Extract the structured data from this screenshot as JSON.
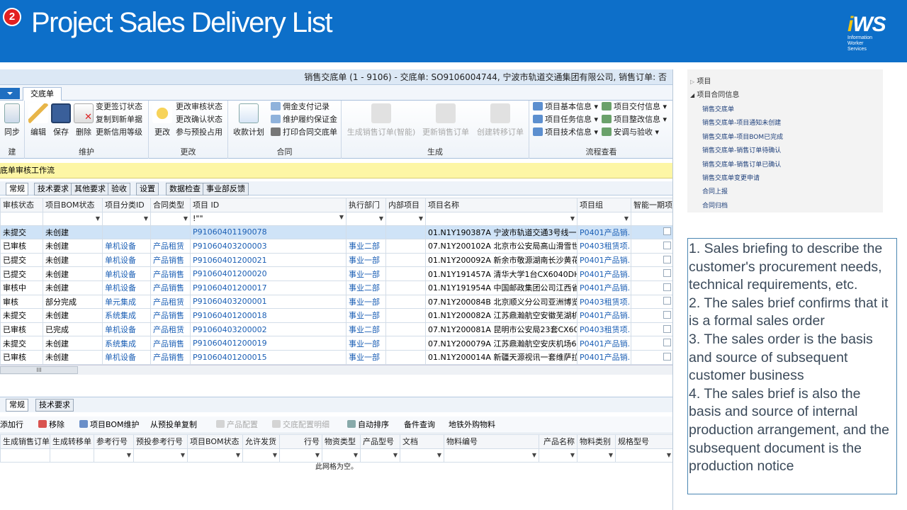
{
  "slide": {
    "number": "2",
    "title": "Project Sales Delivery List",
    "logo": {
      "brand_i": "i",
      "brand_ws": "WS",
      "line1": "Information",
      "line2": "Worker",
      "line3": "Services"
    },
    "colors": {
      "header": "#0d6fc9",
      "badge": "#e32020",
      "logo_dot": "#f4c40f"
    }
  },
  "window": {
    "title": "销售交底单 (1 - 9106) - 交底单: SO9106004744, 宁波市轨道交通集团有限公司, 销售订单: 否"
  },
  "ribbon": {
    "tab": "交底单",
    "groups": {
      "g1": {
        "label": "建",
        "btn": "同步"
      },
      "g2": {
        "label": "维护",
        "edit": "编辑",
        "save": "保存",
        "delete": "删除",
        "s1": "变更签订状态",
        "s2": "复制到新单据",
        "s3": "更新信用等级"
      },
      "g3": {
        "label": "更改",
        "change": "更改",
        "s1": "更改审核状态",
        "s2": "更改确认状态",
        "s3": "参与预投占用"
      },
      "g4": {
        "label": "合同",
        "collect": "收款计划",
        "s1": "佣金支付记录",
        "s2": "维护履约保证金",
        "s3": "打印合同交底单"
      },
      "g5": {
        "label": "生成",
        "b1": "生成销售订单(智能)",
        "b2": "更新销售订单",
        "b3": "创建转移订单"
      },
      "g6": {
        "label": "流程查看",
        "s1": "项目基本信息",
        "s2": "项目任务信息",
        "s3": "项目技术信息",
        "s4": "项目交付信息",
        "s5": "项目整改信息",
        "s6": "安调与验收"
      }
    }
  },
  "workflow_bar": "底单审核工作流",
  "subtabs": [
    "常规",
    "技术要求",
    "其他要求",
    "验收",
    "设置",
    "数据检查",
    "事业部反馈"
  ],
  "grid": {
    "columns": [
      "审核状态",
      "项目BOM状态",
      "项目分类ID",
      "合同类型",
      "项目 ID",
      "执行部门",
      "内部项目",
      "项目名称",
      "项目组",
      "智能一期项"
    ],
    "filter_project_id": "!\"\"",
    "rows": [
      [
        "未提交",
        "未创建",
        "",
        "",
        "P91060401190078",
        "",
        "",
        "01.N1Y190387A 宁波市轨道交通3号线一...",
        "P0401产品销..."
      ],
      [
        "已审核",
        "未创建",
        "单机设备",
        "产品租赁",
        "P91060403200003",
        "事业二部",
        "",
        "07.N1Y200102A 北京市公安局高山滑雪世...",
        "P0403租赁项..."
      ],
      [
        "已提交",
        "未创建",
        "单机设备",
        "产品销售",
        "P91060401200021",
        "事业一部",
        "",
        "01.N1Y200092A 新余市敬源湖南长沙黄花...",
        "P0401产品销..."
      ],
      [
        "已提交",
        "未创建",
        "单机设备",
        "产品销售",
        "P91060401200020",
        "事业一部",
        "",
        "01.N1Y191457A 清华大学1台CX6040DH...",
        "P0401产品销..."
      ],
      [
        "审核中",
        "未创建",
        "单机设备",
        "产品销售",
        "P91060401200017",
        "事业二部",
        "",
        "01.N1Y191954A 中国邮政集团公司江西省...",
        "P0401产品销..."
      ],
      [
        "审核",
        "部分完成",
        "单元集成",
        "产品租赁",
        "P91060403200001",
        "事业一部",
        "",
        "07.N1Y200084B 北京顺义分公司亚洲博览...",
        "P0403租赁项..."
      ],
      [
        "未提交",
        "未创建",
        "系统集成",
        "产品销售",
        "P91060401200018",
        "事业一部",
        "",
        "01.N1Y200082A 江苏鼎瀚航空安徽芜湖机...",
        "P0401产品销..."
      ],
      [
        "已审核",
        "已完成",
        "单机设备",
        "产品租赁",
        "P91060403200002",
        "事业二部",
        "",
        "07.N1Y200081A 昆明市公安局23套CX604...",
        "P0403租赁项..."
      ],
      [
        "未提交",
        "未创建",
        "系统集成",
        "产品销售",
        "P91060401200019",
        "事业一部",
        "",
        "07.N1Y200079A 江苏鼎瀚航空安庆机场6...",
        "P0401产品销..."
      ],
      [
        "已审核",
        "未创建",
        "单机设备",
        "产品销售",
        "P91060401200015",
        "事业一部",
        "",
        "01.N1Y200014A 新疆天源视讯一套维萨拉...",
        "P0401产品销..."
      ]
    ],
    "scroll_thumb": "III"
  },
  "lower": {
    "tabs": [
      "常规",
      "技术要求"
    ],
    "toolbar": {
      "add": "添加行",
      "remove": "移除",
      "bom": "项目BOM维护",
      "copy": "从预投单复制",
      "config": "产品配置",
      "config_detail": "交底配置明细",
      "auto": "自动排序",
      "spare": "备件查询",
      "metro": "地铁外购物料"
    },
    "columns": [
      "生成销售订单",
      "生成转移单",
      "参考行号",
      "预投参考行号",
      "项目BOM状态",
      "允许发货",
      "行号",
      "物资类型",
      "产品型号",
      "文档",
      "物料编号",
      "产品名称",
      "物料类别",
      "规格型号"
    ],
    "empty": "此网格为空。"
  },
  "tree": {
    "node1": "项目",
    "node2": "项目合同信息",
    "leaves": [
      "销售交底单",
      "销售交底单-项目通知未创建",
      "销售交底单-项目BOM已完成",
      "销售交底单-销售订单待确认",
      "销售交底单-销售订单已确认",
      "销售交底单变更申请",
      "合同上报",
      "合同归档"
    ]
  },
  "notes": "1. Sales briefing to describe the customer's procurement needs, technical requirements, etc.\n2. The sales brief confirms that it is a formal sales order\n3. The sales order is the basis and source of subsequent customer business\n4. The sales brief is also the basis and source of internal production arrangement, and the subsequent document is the production notice"
}
